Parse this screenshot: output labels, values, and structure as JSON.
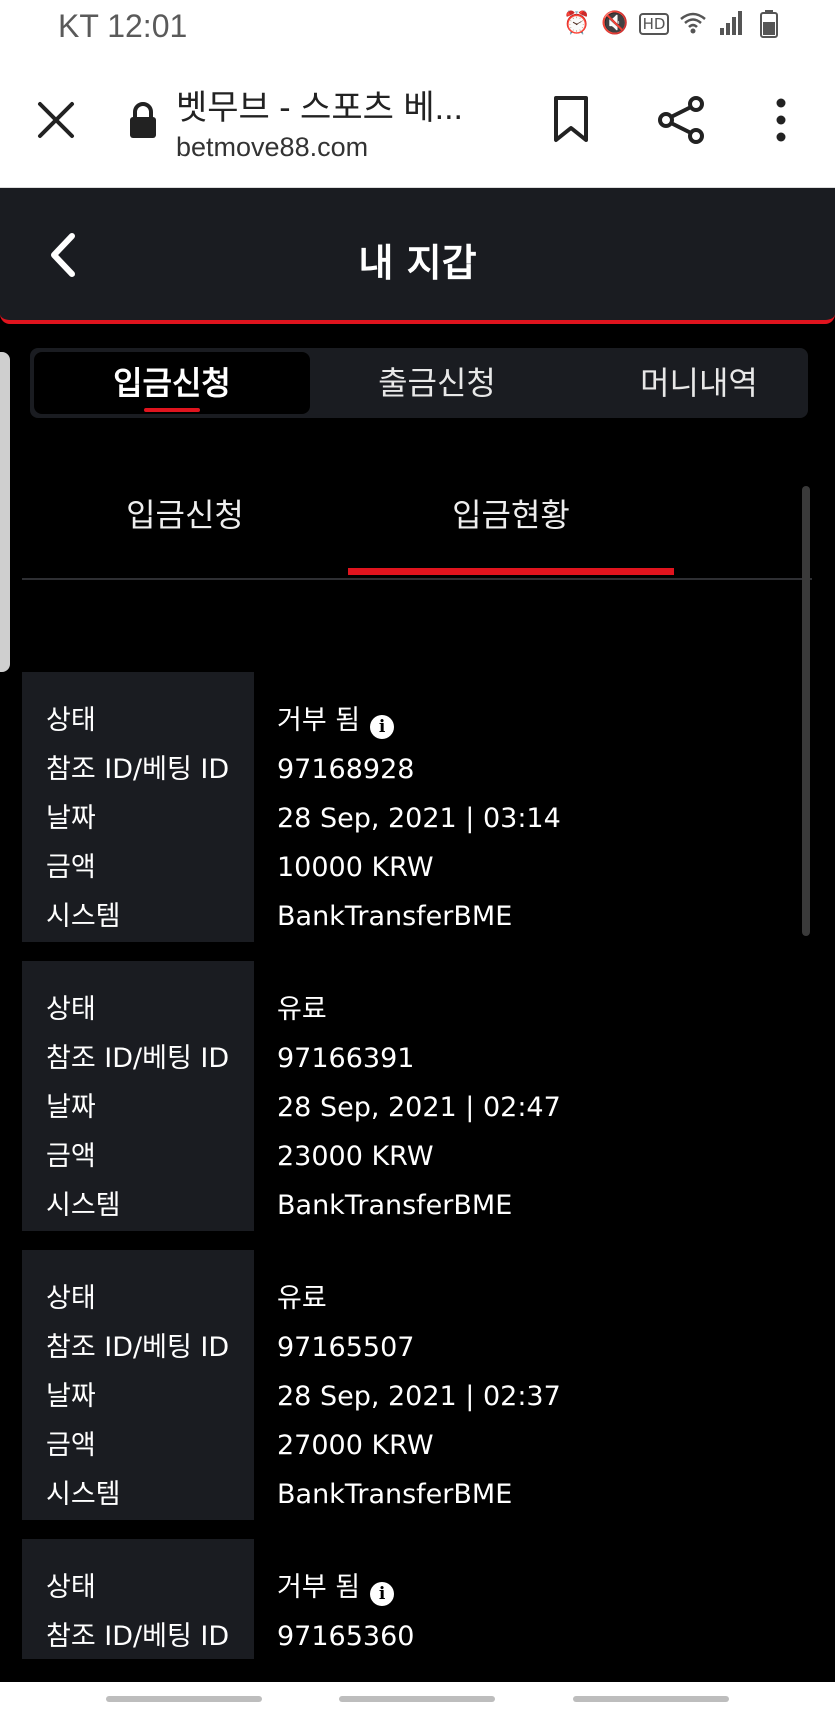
{
  "status": {
    "carrier_time": "KT 12:01",
    "icons": [
      "alarm-icon",
      "mute-icon",
      "hd-icon",
      "wifi-icon",
      "signal-icon",
      "battery-icon"
    ]
  },
  "browser": {
    "title": "벳무브 - 스포츠 베...",
    "domain": "betmove88.com"
  },
  "header": {
    "title": "내 지갑"
  },
  "main_tabs": [
    {
      "label": "입금신청",
      "active": true
    },
    {
      "label": "출금신청",
      "active": false
    },
    {
      "label": "머니내역",
      "active": false
    }
  ],
  "sub_tabs": [
    {
      "label": "입금신청",
      "active": false
    },
    {
      "label": "입금현황",
      "active": true
    }
  ],
  "labels": {
    "status": "상태",
    "ref_id": "참조 ID/베팅 ID",
    "date": "날짜",
    "amount": "금액",
    "system": "시스템"
  },
  "records": [
    {
      "status": "거부 됨",
      "ref_id": "97168928",
      "date": "28 Sep, 2021 | 03:14",
      "amount": "10000 KRW",
      "system": "BankTransferBME"
    },
    {
      "status": "유료",
      "ref_id": "97166391",
      "date": "28 Sep, 2021 | 02:47",
      "amount": "23000 KRW",
      "system": "BankTransferBME"
    },
    {
      "status": "유료",
      "ref_id": "97165507",
      "date": "28 Sep, 2021 | 02:37",
      "amount": "27000 KRW",
      "system": "BankTransferBME"
    },
    {
      "status": "거부 됨",
      "ref_id": "97165360"
    }
  ],
  "colors": {
    "accent": "#e0141e",
    "panel": "#1a1c21",
    "background": "#000000"
  }
}
